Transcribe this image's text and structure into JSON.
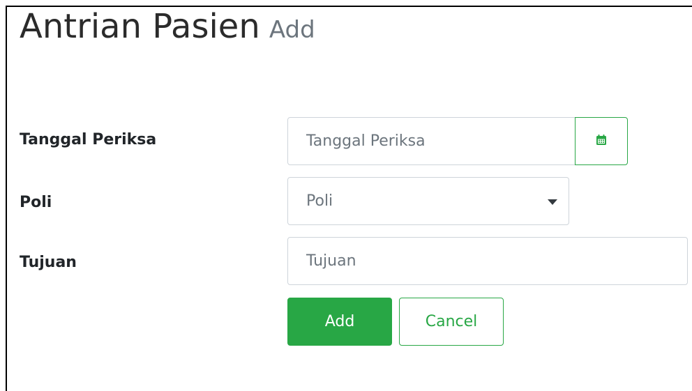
{
  "page": {
    "title": "Antrian Pasien",
    "subtitle": "Add"
  },
  "form": {
    "tanggal_periksa": {
      "label": "Tanggal Periksa",
      "placeholder": "Tanggal Periksa",
      "value": ""
    },
    "calendar_button": {
      "icon": "calendar-icon"
    },
    "poli": {
      "label": "Poli",
      "selected": "Poli"
    },
    "tujuan": {
      "label": "Tujuan",
      "placeholder": "Tujuan",
      "value": ""
    }
  },
  "actions": {
    "add_label": "Add",
    "cancel_label": "Cancel"
  },
  "colors": {
    "primary_green": "#28a745",
    "text": "#212529",
    "muted": "#6c757d",
    "border": "#ced4da"
  }
}
